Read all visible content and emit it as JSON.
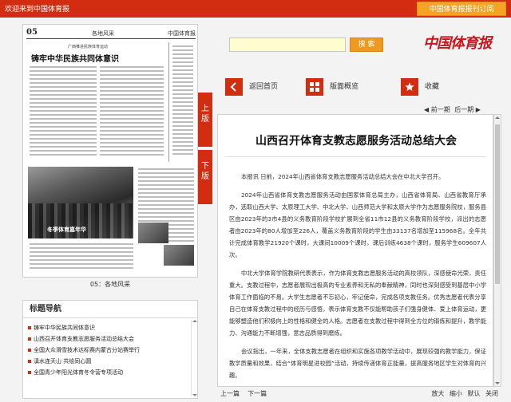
{
  "topbar": {
    "welcome": "欢迎来到中国体育报",
    "subscribe": "中国体育报报刊订阅"
  },
  "paper_page": {
    "page_number": "05",
    "section": "各地风采",
    "brand": "中国体育报",
    "kicker": "广西推进民族体育运动",
    "headline": "铸牢中华民族共同体意识",
    "photo_caption": "冬季体育嘉年华"
  },
  "page_caption": "05：各地风采",
  "side_tabs": {
    "prev": [
      "上",
      "版"
    ],
    "next": [
      "下",
      "版"
    ]
  },
  "title_nav": {
    "header": "标题导航",
    "items": [
      "铸牢中华民族共同体意识",
      "山西召开体育支教志愿服务活动总结大会",
      "全国大众滑雪技术达标赛内蒙古分站赛举行",
      "滇水连天山 共绘同心圆",
      "全国青少年阳光体育冬令营专项活动"
    ]
  },
  "search": {
    "placeholder": "",
    "button": "搜 索"
  },
  "logo": "中国体育报",
  "toolbar": {
    "home": "返回首页",
    "overview": "版面概览",
    "favorite": "收藏"
  },
  "pager_top": {
    "prev": "◀ 前一期",
    "next": "后一期 ▶"
  },
  "article": {
    "title": "山西召开体育支教志愿服务活动总结大会",
    "paragraphs": [
      "本报讯 日前，2024年山西省体育支教志愿服务活动总结大会在中北大学召开。",
      "2024年山西省体育支教志愿服务活动由国家体育总局主办，山西省体育局、山西省教育厅承办，选取山西大学、太原理工大学、中北大学、山西师范大学和太原大学作为志愿服务院校，服务县区由2023年的3市4县的义务教育阶段学校扩展到全省11市12县的义务教育阶段学校，派出的志愿者由2023年的80人增加至226人，覆盖义务教育阶段的学生由33137名增加至115968名。全年共计完成体育教学21920个课时，大课间10009个课时，课后训练4638个课时，服务学生609607人次。",
      "中北大学体育学院教研代表表示，作为体育支教志愿服务活动的高校领队，深感使命光荣，责任重大。支教过程中，志愿者展现出极高的专业素养和无私的奉献精神，同时也深刻感受到基层中小学体育工作面临的不易。大学生志愿者不忘初心，牢记使命，完成各项支教任务。优秀志愿者代表分享自己在体育支教过程中的经历与感悟，表示体育支教不仅能帮助孩子们强身健体、爱上体育运动，更能够塑造他们积极向上的性格和健全的人格。志愿者在支教过程中得到全方位的锻炼和提升，教学能力、沟通能力不断增强，意志品质得到磨炼。",
      "会议指出，一年来，全体支教志愿者在组织和实施各项教学活动中，展现较强的教学能力，保证教学质量和效果，结合“体育明星进校园”活动，持续传递体育正能量，提高服务地区学生对体育的兴趣。"
    ]
  },
  "bottombar": {
    "prev": "上一篇",
    "next": "下一篇",
    "zoom_in": "放大",
    "zoom_out": "缩小",
    "default": "默认",
    "close": "关闭"
  },
  "colors": {
    "brand_red": "#d22d10",
    "accent_orange": "#ee9a21"
  }
}
